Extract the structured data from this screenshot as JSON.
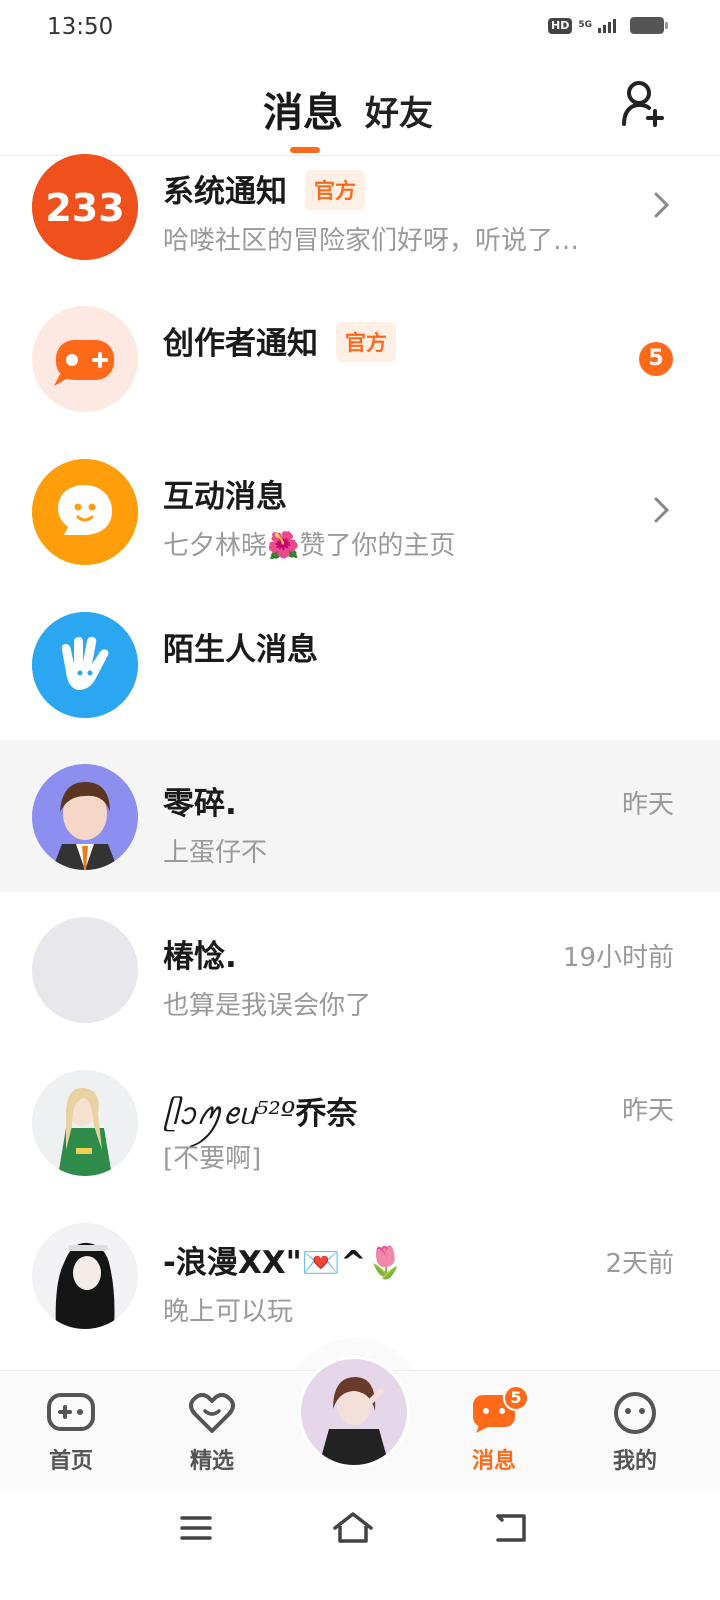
{
  "status_bar": {
    "time": "13:50",
    "hd": "HD",
    "network": "5G"
  },
  "header": {
    "tab_messages": "消息",
    "tab_friends": "好友"
  },
  "system_rows": [
    {
      "title": "系统通知",
      "tag": "官方",
      "subtitle": "哈喽社区的冒险家们好呀，听说了…",
      "logo_text": "233"
    },
    {
      "title": "创作者通知",
      "tag": "官方",
      "badge": "5"
    },
    {
      "title": "互动消息",
      "subtitle": "七夕林晓🌺赞了你的主页"
    },
    {
      "title": "陌生人消息"
    }
  ],
  "chats": [
    {
      "name": "零碎.",
      "message": "上蛋仔不",
      "time": "昨天"
    },
    {
      "name": "椿惗.",
      "message": "也算是我误会你了",
      "time": "19小时前"
    },
    {
      "name": "乔奈",
      "name_prefix": "ᥫᩣꪑꫀᥙ⁵²º",
      "message": "[不要啊]",
      "time": "昨天"
    },
    {
      "name": "-浪漫XX\"💌^🌷",
      "message": "晚上可以玩",
      "time": "2天前"
    }
  ],
  "bottom_nav": {
    "home": "首页",
    "featured": "精选",
    "messages": "消息",
    "messages_badge": "5",
    "me": "我的"
  },
  "colors": {
    "accent": "#ff6a1a",
    "blue": "#2aa7f0",
    "gray_text": "#9a9a9a"
  }
}
